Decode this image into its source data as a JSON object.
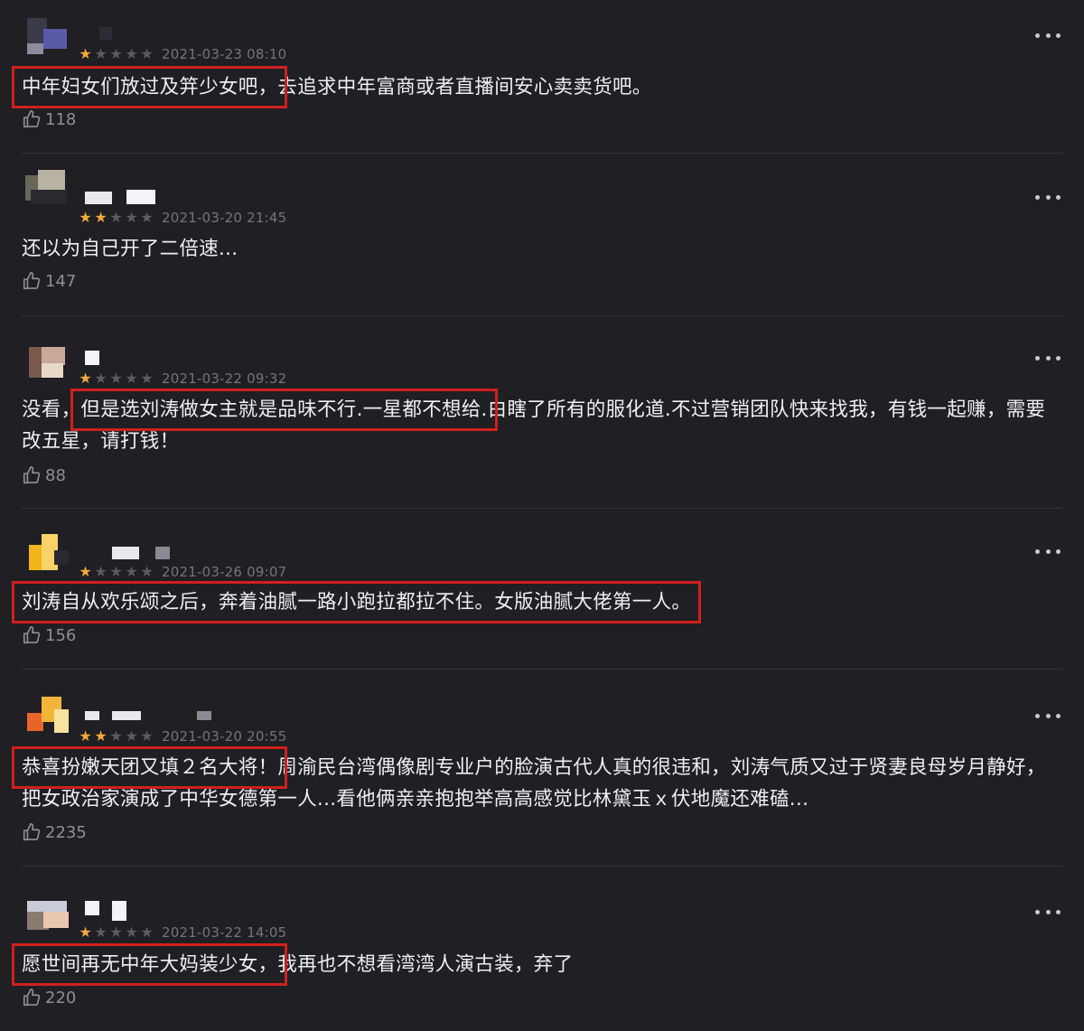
{
  "reviews": [
    {
      "time": "2021-03-23 08:10",
      "rating": 1,
      "highlight": "中年妇女们放过及笄少女吧，",
      "after": "去追求中年富商或者直播间安心卖卖货吧。",
      "likes": "118",
      "avatar_colors": [
        "#3a3a48",
        "#5a5aa8",
        "#8c8c9a"
      ]
    },
    {
      "time": "2021-03-20 21:45",
      "rating": 2,
      "text": "还以为自己开了二倍速...",
      "likes": "147",
      "avatar_colors": [
        "#6a665c",
        "#b8b2a2",
        "#2a2a2e"
      ]
    },
    {
      "time": "2021-03-22 09:32",
      "rating": 1,
      "before": "没看，",
      "highlight": "但是选刘涛做女主就是品味不行.一星都不想给.",
      "after": "白瞎了所有的服化道.不过营销团队快来找我，有钱一起赚，需要改五星，请打钱！",
      "likes": "88",
      "avatar_colors": [
        "#7a5a4a",
        "#c8a898",
        "#e8d8c8"
      ]
    },
    {
      "time": "2021-03-26 09:07",
      "rating": 1,
      "highlight": "刘涛自从欢乐颂之后，奔着油腻一路小跑拉都拉不住。女版油腻大佬第一人。",
      "likes": "156",
      "avatar_colors": [
        "#f3b51b",
        "#f7d36a",
        "#2a2a2e"
      ]
    },
    {
      "time": "2021-03-20 20:55",
      "rating": 2,
      "highlight": "恭喜扮嫩天团又填２名大将！",
      "after": "周渝民台湾偶像剧专业户的脸演古代人真的很违和，刘涛气质又过于贤妻良母岁月静好，把女政治家演成了中华女德第一人...看他俩亲亲抱抱举高高感觉比林黛玉ｘ伏地魔还难磕...",
      "likes": "2235",
      "avatar_colors": [
        "#e8652a",
        "#f2b53a",
        "#f7e2a0"
      ]
    },
    {
      "time": "2021-03-22 14:05",
      "rating": 1,
      "highlight": "愿世间再无中年大妈装少女，",
      "after": "我再也不想看湾湾人演古装，弃了",
      "likes": "220",
      "avatar_colors": [
        "#c8ccd8",
        "#8a7a70",
        "#e8c8b0"
      ]
    }
  ]
}
